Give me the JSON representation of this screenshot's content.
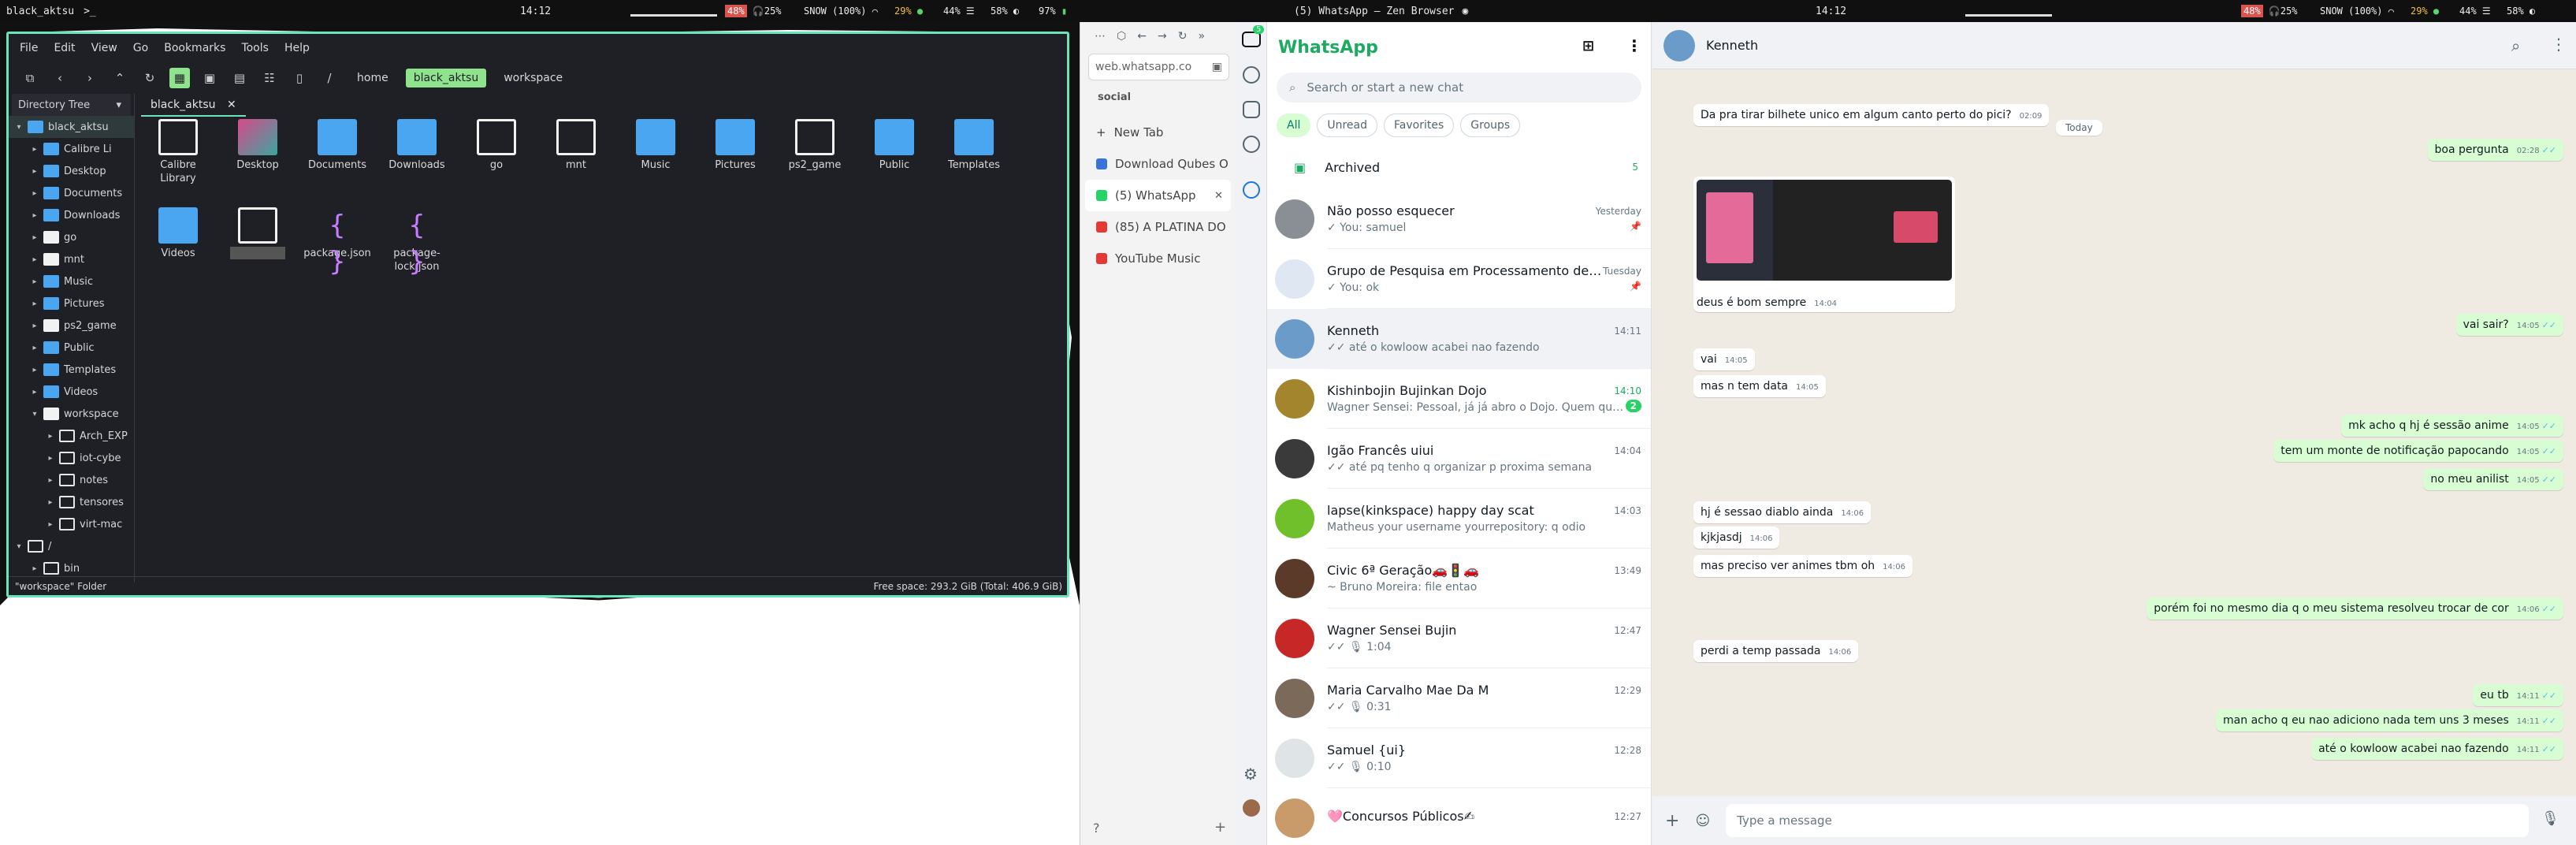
{
  "topbar": {
    "left": {
      "title": "black_aktsu",
      "prompt": ">_",
      "clock": "14:12",
      "battery": "48%",
      "headset": "25%",
      "snow": "SNOW (100%)",
      "cpu": "29%",
      "mem": "44%",
      "disk": "58%",
      "vol": "97%"
    },
    "right": {
      "title": "(5) WhatsApp — Zen Browser",
      "clock": "14:12",
      "battery": "48%",
      "headset": "25%",
      "snow": "SNOW (100%)",
      "cpu": "29%",
      "mem": "44%",
      "disk": "58%",
      "vol": "97%"
    }
  },
  "filemanager": {
    "menu": [
      "File",
      "Edit",
      "View",
      "Go",
      "Bookmarks",
      "Tools",
      "Help"
    ],
    "breadcrumbs": [
      "home",
      "black_aktsu",
      "workspace"
    ],
    "sidebar_title": "Directory Tree",
    "tree": [
      {
        "label": "black_aktsu",
        "indent": 0,
        "open": true,
        "color": "blue"
      },
      {
        "label": "Calibre Li",
        "indent": 1,
        "color": "blue"
      },
      {
        "label": "Desktop",
        "indent": 1,
        "color": "blue"
      },
      {
        "label": "Documents",
        "indent": 1,
        "color": "blue"
      },
      {
        "label": "Downloads",
        "indent": 1,
        "color": "blue"
      },
      {
        "label": "go",
        "indent": 1,
        "color": "white"
      },
      {
        "label": "mnt",
        "indent": 1,
        "color": "white"
      },
      {
        "label": "Music",
        "indent": 1,
        "color": "blue"
      },
      {
        "label": "Pictures",
        "indent": 1,
        "color": "blue"
      },
      {
        "label": "ps2_game",
        "indent": 1,
        "color": "white"
      },
      {
        "label": "Public",
        "indent": 1,
        "color": "blue"
      },
      {
        "label": "Templates",
        "indent": 1,
        "color": "blue"
      },
      {
        "label": "Videos",
        "indent": 1,
        "color": "blue"
      },
      {
        "label": "workspace",
        "indent": 1,
        "open": true,
        "color": "white"
      },
      {
        "label": "Arch_EXP",
        "indent": 2,
        "color": "out"
      },
      {
        "label": "iot-cybe",
        "indent": 2,
        "color": "out"
      },
      {
        "label": "notes",
        "indent": 2,
        "color": "out"
      },
      {
        "label": "tensores",
        "indent": 2,
        "color": "out"
      },
      {
        "label": "virt-mac",
        "indent": 2,
        "color": "out"
      },
      {
        "label": "/",
        "indent": 0,
        "open": true,
        "color": "out"
      },
      {
        "label": "bin",
        "indent": 1,
        "color": "out"
      }
    ],
    "tab": "black_aktsu",
    "items": [
      {
        "label": "Calibre Library",
        "kind": "white"
      },
      {
        "label": "Desktop",
        "kind": "desktop"
      },
      {
        "label": "Documents",
        "kind": "blue"
      },
      {
        "label": "Downloads",
        "kind": "blue"
      },
      {
        "label": "go",
        "kind": "white"
      },
      {
        "label": "mnt",
        "kind": "white"
      },
      {
        "label": "Music",
        "kind": "blue"
      },
      {
        "label": "Pictures",
        "kind": "blue"
      },
      {
        "label": "ps2_game",
        "kind": "white"
      },
      {
        "label": "Public",
        "kind": "blue"
      },
      {
        "label": "Templates",
        "kind": "blue"
      },
      {
        "label": "Videos",
        "kind": "blue"
      },
      {
        "label": "",
        "kind": "selected"
      },
      {
        "label": "package.json",
        "kind": "json"
      },
      {
        "label": "package-lock.json",
        "kind": "json"
      }
    ],
    "status_left": "\"workspace\" Folder",
    "status_right": "Free space: 293.2 GiB (Total: 406.9 GiB)"
  },
  "browser": {
    "url": "web.whatsapp.co",
    "space_label": "social",
    "new_tab": "New Tab",
    "tabs": [
      {
        "label": "Download Qubes O",
        "color": "#3874d8"
      },
      {
        "label": "(5) WhatsApp",
        "color": "#25d366",
        "active": true
      },
      {
        "label": "(85) A PLATINA DO",
        "color": "#e53935"
      },
      {
        "label": "YouTube Music",
        "color": "#e53935"
      }
    ],
    "strip_badge": "5"
  },
  "whatsapp": {
    "title": "WhatsApp",
    "search_placeholder": "Search or start a new chat",
    "filters": [
      "All",
      "Unread",
      "Favorites",
      "Groups"
    ],
    "archived_label": "Archived",
    "archived_count": "5",
    "chats": [
      {
        "name": "Não posso esquecer",
        "last": "✓ You: samuel",
        "time": "Yesterday",
        "pinned": true,
        "avatar": "#8a8f96"
      },
      {
        "name": "Grupo de Pesquisa em Processamento de ...",
        "last": "✓ You: ok",
        "time": "Tuesday",
        "pinned": true,
        "avatar": "#dfe7f2"
      },
      {
        "name": "Kenneth",
        "last": "✓✓ até o kowloow acabei nao fazendo",
        "time": "14:11",
        "selected": true,
        "avatar": "#6a9bc9"
      },
      {
        "name": "Kishinbojin Bujinkan Dojo",
        "last": "Wagner Sensei: Pessoal, já já abro o Dojo. Quem quiser ...",
        "time": "14:10",
        "unread": "2",
        "avatar": "#a3852e"
      },
      {
        "name": "Igão Francês uiui",
        "last": "✓✓ até pq tenho q organizar p proxima semana",
        "time": "14:04",
        "avatar": "#3a3a3a"
      },
      {
        "name": "lapse(kinkspace) happy day scat",
        "last": "Matheus your username yourrepository: q odio",
        "time": "14:03",
        "avatar": "#6fc02a"
      },
      {
        "name": "Civic 6ª Geração🚗🚦🚗",
        "last": "~ Bruno Moreira: file entao",
        "time": "13:49",
        "avatar": "#5b3a2a"
      },
      {
        "name": "Wagner Sensei Bujin",
        "last": "✓✓ 🎙 1:04",
        "time": "12:47",
        "avatar": "#c62828"
      },
      {
        "name": "Maria Carvalho Mae Da M",
        "last": "✓✓ 🎙 0:31",
        "time": "12:29",
        "avatar": "#7b6a5a"
      },
      {
        "name": "Samuel {ui}",
        "last": "✓✓ 🎙 0:10",
        "time": "12:28",
        "avatar": "#dfe5e7"
      },
      {
        "name": "🩷Concursos Públicos✍",
        "last": "",
        "time": "12:27",
        "avatar": "#c99a6a"
      }
    ],
    "conversation": {
      "name": "Kenneth",
      "day": "Today",
      "compose_placeholder": "Type a message",
      "messages": [
        {
          "dir": "in",
          "text": "Da pra tirar bilhete unico em algum canto perto do pici?",
          "time": "02:09"
        },
        {
          "dir": "out",
          "text": "boa pergunta",
          "time": "02:28"
        },
        {
          "dir": "in",
          "text": "deus é bom sempre",
          "time": "14:04",
          "image": true
        },
        {
          "dir": "out",
          "text": "vai sair?",
          "time": "14:05"
        },
        {
          "dir": "in",
          "text": "vai",
          "time": "14:05"
        },
        {
          "dir": "in",
          "text": "mas n tem data",
          "time": "14:05"
        },
        {
          "dir": "out",
          "text": "mk acho q hj é sessão anime",
          "time": "14:05"
        },
        {
          "dir": "out",
          "text": "tem um monte de notificação papocando",
          "time": "14:05"
        },
        {
          "dir": "out",
          "text": "no meu anilist",
          "time": "14:05"
        },
        {
          "dir": "in",
          "text": "hj é sessao diablo ainda",
          "time": "14:06"
        },
        {
          "dir": "in",
          "text": "kjkjasdj",
          "time": "14:06"
        },
        {
          "dir": "in",
          "text": "mas preciso ver animes tbm oh",
          "time": "14:06"
        },
        {
          "dir": "out",
          "text": "porém foi no mesmo dia q o meu sistema resolveu trocar de cor",
          "time": "14:06"
        },
        {
          "dir": "in",
          "text": "perdi a temp passada",
          "time": "14:06"
        },
        {
          "dir": "out",
          "text": "eu tb",
          "time": "14:11"
        },
        {
          "dir": "out",
          "text": "man acho q eu nao adiciono nada tem uns 3 meses",
          "time": "14:11"
        },
        {
          "dir": "out",
          "text": "até o kowloow acabei nao fazendo",
          "time": "14:11"
        }
      ]
    }
  }
}
